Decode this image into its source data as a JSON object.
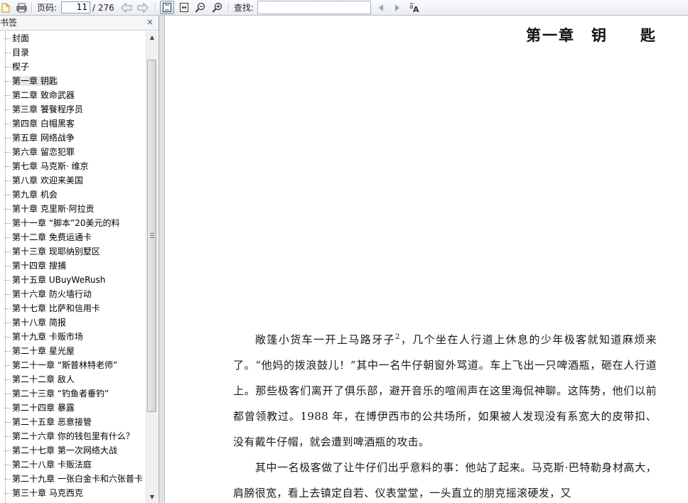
{
  "toolbar": {
    "page_label": "页码:",
    "current_page": "11",
    "total_pages": "/ 276",
    "search_label": "查找:",
    "search_value": ""
  },
  "sidebar": {
    "title": "书签",
    "close": "×",
    "items": [
      {
        "label": "封面"
      },
      {
        "label": "目录"
      },
      {
        "label": "楔子"
      },
      {
        "label": "第一章 钥匙"
      },
      {
        "label": "第二章 致命武器"
      },
      {
        "label": "第三章 饕餮程序员"
      },
      {
        "label": "第四章 白帽黑客"
      },
      {
        "label": "第五章 网络战争"
      },
      {
        "label": "第六章 留恋犯罪"
      },
      {
        "label": "第七章 马克斯· 维京"
      },
      {
        "label": "第八章 欢迎来美国"
      },
      {
        "label": "第九章 机会"
      },
      {
        "label": "第十章 克里斯·阿拉贡"
      },
      {
        "label": "第十一章 “脚本”20美元的料"
      },
      {
        "label": "第十二章 免费运通卡"
      },
      {
        "label": "第十三章 现耶纳别墅区"
      },
      {
        "label": "第十四章 搜捕"
      },
      {
        "label": "第十五章 UBuyWeRush"
      },
      {
        "label": "第十六章 防火墙行动"
      },
      {
        "label": "第十七章 比萨和信用卡"
      },
      {
        "label": "第十八章 简报"
      },
      {
        "label": "第十九章 卡贩市场"
      },
      {
        "label": "第二十章 星光屋"
      },
      {
        "label": "第二十一章 “斯普林特老师”"
      },
      {
        "label": "第二十二章 敌人"
      },
      {
        "label": "第二十三章 “钓鱼者垂钓”"
      },
      {
        "label": "第二十四章 暴露"
      },
      {
        "label": "第二十五章 恶意接管"
      },
      {
        "label": "第二十六章 你的钱包里有什么？"
      },
      {
        "label": "第二十七章 第一次网络大战"
      },
      {
        "label": "第二十八章 卡贩法庭"
      },
      {
        "label": "第二十九章 一张白金卡和六张普卡"
      },
      {
        "label": "第三十章 马克西克"
      }
    ],
    "selected_index": 3
  },
  "document": {
    "chapter_title": "第一章　钥　　匙",
    "para1_a": "敞篷小货车一开上马路牙子",
    "para1_note": "2",
    "para1_b": "，几个坐在人行道上休息的少年极客就知道麻烦来了。“他妈的拨浪鼓儿！”其中一名牛仔朝窗外骂道。车上飞出一只啤酒瓶，砸在人行道上。那些极客们离开了俱乐部，避开音乐的喧闹声在这里海侃神聊。这阵势，他们以前都曾领教过。1988 年，在博伊西市的公共场所，如果被人发现没有系宽大的皮带扣、没有戴牛仔帽，就会遭到啤酒瓶的攻击。",
    "para2": "其中一名极客做了让牛仔们出乎意料的事：他站了起来。马克斯·巴特勒身材高大，肩膀很宽，看上去镇定自若、仪表堂堂，一头直立的朋克摇滚硬发，又"
  }
}
